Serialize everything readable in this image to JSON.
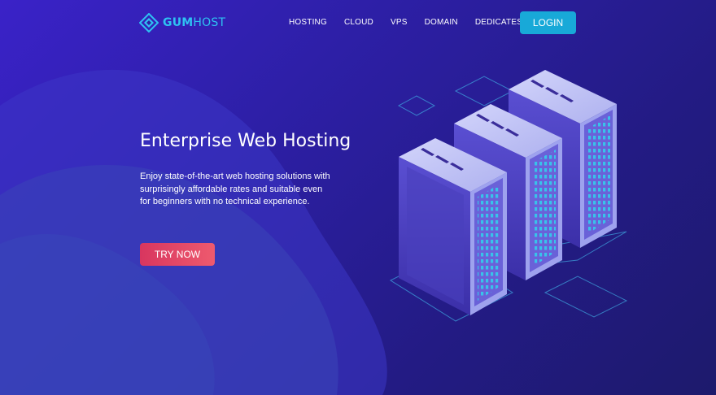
{
  "brand": {
    "name_bold": "GUM",
    "name_light": "HOST",
    "color": "#2ec2f2"
  },
  "nav": {
    "items": [
      {
        "label": "HOSTING"
      },
      {
        "label": "CLOUD"
      },
      {
        "label": "VPS"
      },
      {
        "label": "DOMAIN"
      },
      {
        "label": "DEDICATES"
      }
    ],
    "login_label": "LOGIN"
  },
  "hero": {
    "title": "Enterprise Web Hosting",
    "description": "Enjoy state-of-the-art web hosting solutions with surprisingly affordable rates and suitable even for beginners with no technical experience.",
    "cta_label": "TRY NOW"
  },
  "colors": {
    "background": "#2d1fa6",
    "accent_cyan": "#18a9d8",
    "cta_pink": "#e0445f"
  },
  "icons": [
    "diamond-logo-icon",
    "server-rack-illustration"
  ]
}
